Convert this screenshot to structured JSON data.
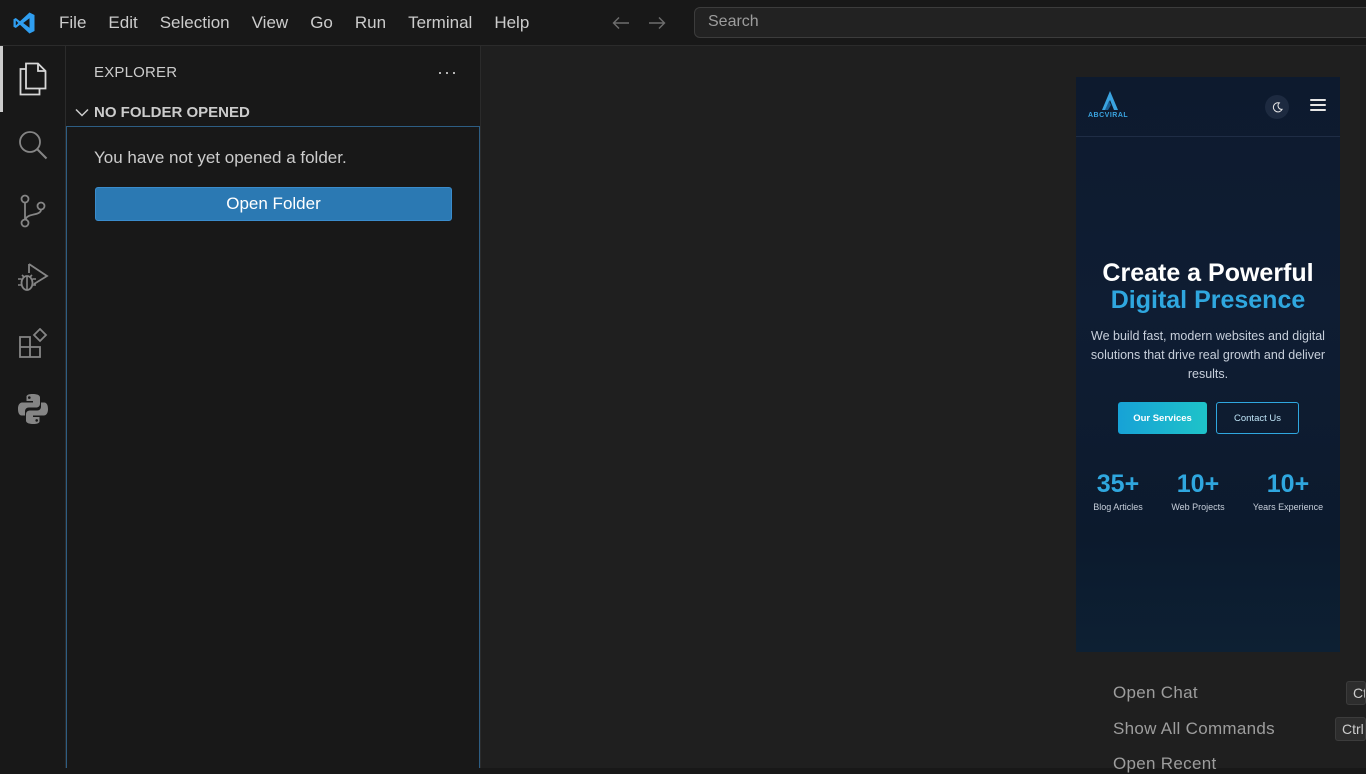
{
  "menu": [
    "File",
    "Edit",
    "Selection",
    "View",
    "Go",
    "Run",
    "Terminal",
    "Help"
  ],
  "search": {
    "placeholder": "Search"
  },
  "activity": {
    "icons": [
      "files-icon",
      "search-icon",
      "source-control-icon",
      "run-debug-icon",
      "extensions-icon",
      "python-icon"
    ]
  },
  "sidebar": {
    "title": "EXPLORER",
    "more": "···",
    "section": "NO FOLDER OPENED",
    "empty_text": "You have not yet opened a folder.",
    "open_folder": "Open Folder"
  },
  "preview": {
    "brand": "ABCVIRAL",
    "headline_1": "Create a Powerful",
    "headline_2": "Digital Presence",
    "subtitle": "We build fast, modern websites and digital solutions that drive real growth and deliver results.",
    "btn_primary": "Our Services",
    "btn_secondary": "Contact Us",
    "stats": [
      {
        "num": "35+",
        "label": "Blog Articles"
      },
      {
        "num": "10+",
        "label": "Web Projects"
      },
      {
        "num": "10+",
        "label": "Years Experience"
      }
    ]
  },
  "hints": [
    {
      "label": "Open Chat",
      "key": "Ct"
    },
    {
      "label": "Show All Commands",
      "key": "Ctrl"
    },
    {
      "label": "Open Recent",
      "key": ""
    }
  ],
  "colors": {
    "accent": "#2b79b3",
    "cyan": "#2fa7df",
    "background": "#181818"
  }
}
